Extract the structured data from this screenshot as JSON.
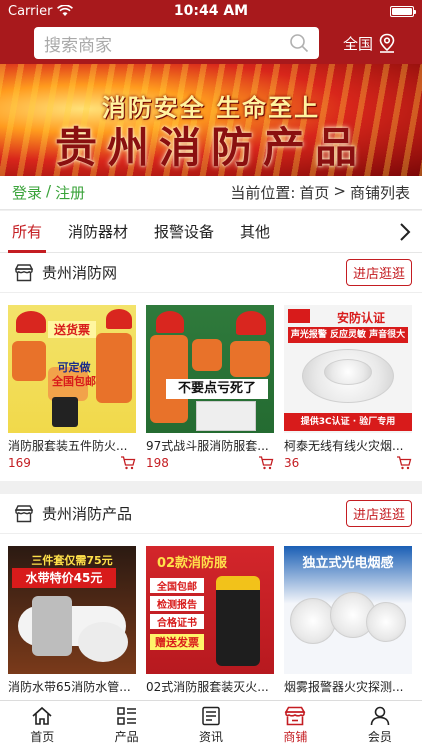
{
  "status": {
    "carrier": "Carrier",
    "time": "10:44 AM"
  },
  "search": {
    "placeholder": "搜索商家",
    "region": "全国"
  },
  "banner": {
    "slogan": "消防安全  生命至上",
    "title": "贵州消防产品"
  },
  "location": {
    "login": "登录",
    "sep": "/",
    "register": "注册",
    "current": "当前位置:",
    "home": "首页",
    "arrow": ">",
    "page": "商铺列表"
  },
  "tabs": [
    "所有",
    "消防器材",
    "报警设备",
    "其他"
  ],
  "shops": [
    {
      "name": "贵州消防网",
      "enter_label": "进店逛逛",
      "products": [
        {
          "title": "消防服套装五件防火...",
          "price": "169",
          "img_text": [
            "送货票",
            "可定做",
            "全国包邮"
          ]
        },
        {
          "title": "97式战斗服消防服套...",
          "price": "198",
          "img_text": [
            "不要点亏死了"
          ]
        },
        {
          "title": "柯泰无线有线火灾烟...",
          "price": "36",
          "img_text": [
            "安防认证",
            "声光报警 反应灵敏 声音很大",
            "提供3C认证 · 验厂专用"
          ]
        }
      ]
    },
    {
      "name": "贵州消防产品",
      "enter_label": "进店逛逛",
      "products": [
        {
          "title": "消防水带65消防水管...",
          "price": "",
          "img_text": [
            "三件套仅需75元",
            "水带特价45元"
          ]
        },
        {
          "title": "02式消防服套装灭火...",
          "price": "",
          "img_text": [
            "02款消防服",
            "全国包邮",
            "检测报告",
            "合格证书",
            "赠送发票"
          ]
        },
        {
          "title": "烟雾报警器火灾探测...",
          "price": "",
          "img_text": [
            "独立式光电烟感"
          ]
        }
      ]
    }
  ],
  "bottom_nav": [
    "首页",
    "产品",
    "资讯",
    "商铺",
    "会员"
  ],
  "colors": {
    "brand": "#a8191c",
    "accent": "#c41d22",
    "login": "#3aa33a"
  }
}
